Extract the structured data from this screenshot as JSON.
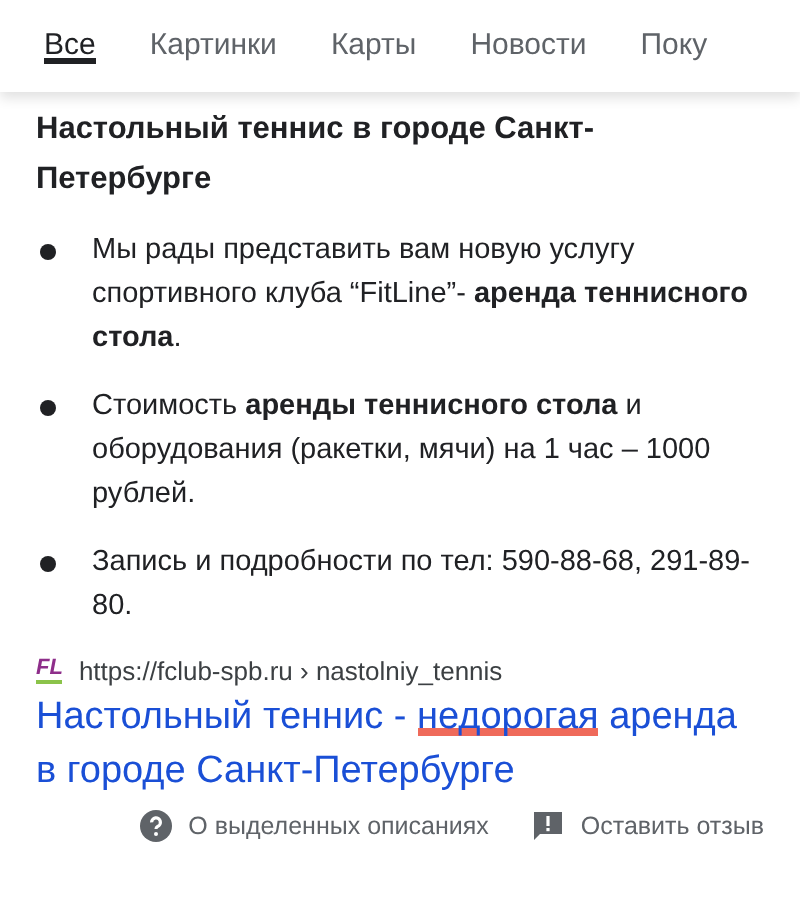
{
  "tabs": [
    {
      "label": "Все",
      "selected": true
    },
    {
      "label": "Картинки",
      "selected": false
    },
    {
      "label": "Карты",
      "selected": false
    },
    {
      "label": "Новости",
      "selected": false
    },
    {
      "label": "Поку",
      "selected": false
    }
  ],
  "snippet": {
    "heading": "Настольный теннис в городе Санкт-Петербурге",
    "bullets": [
      "Мы рады представить вам новую услугу спортивного клуба “FitLine”- **аренда теннисного стола**.",
      "Стоимость **аренды теннисного стола** и оборудования (ракетки, мячи) на 1 час – 1000 рублей.",
      "Запись и подробности по тел: 590-88-68, 291-89-80."
    ]
  },
  "result": {
    "site_logo": "FL",
    "url": "https://fclub-spb.ru › nastolniy_tennis",
    "title_parts": [
      {
        "text": "Настольный теннис - ",
        "marked": false
      },
      {
        "text": "недорогая",
        "marked": true
      },
      {
        "text": " аренда в городе Санкт-Петербурге",
        "marked": false
      }
    ]
  },
  "footer": [
    {
      "kind": "help",
      "label": "О выделенных описаниях"
    },
    {
      "kind": "feedback",
      "label": "Оставить отзыв"
    }
  ]
}
